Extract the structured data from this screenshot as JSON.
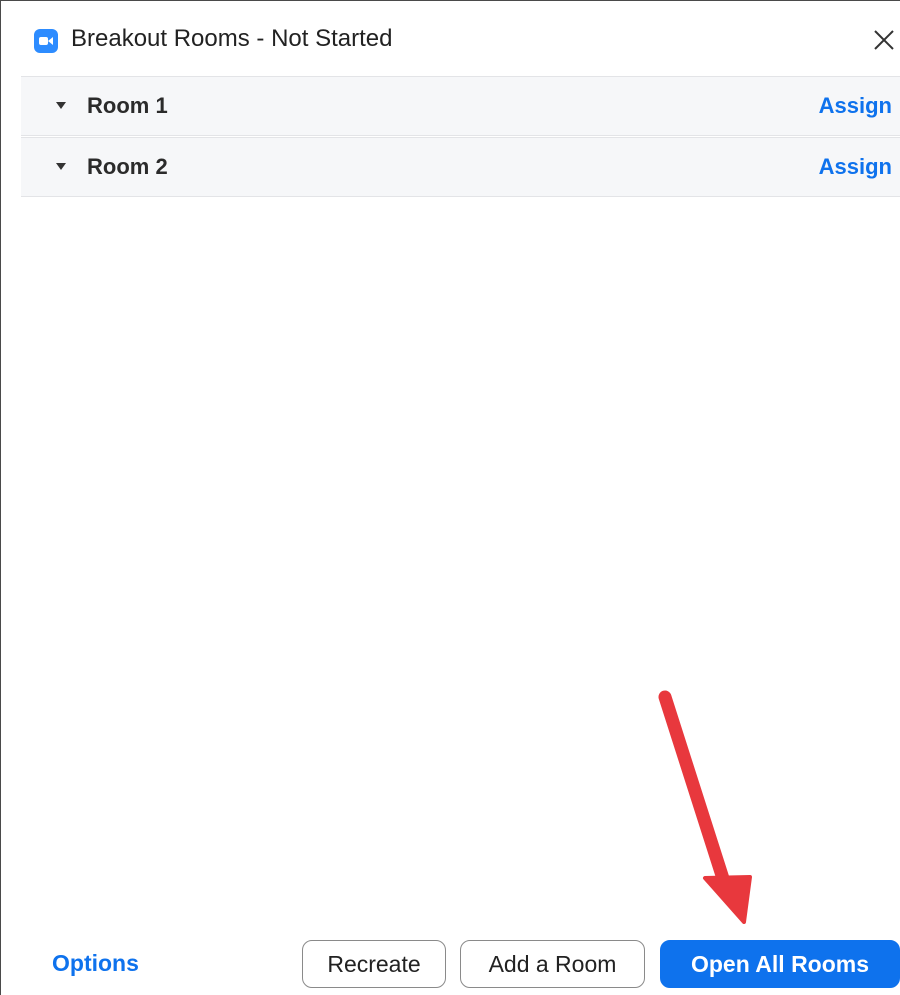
{
  "window": {
    "title": "Breakout Rooms - Not Started",
    "app_icon": "zoom-camera-icon",
    "close_icon": "close-icon"
  },
  "rooms": [
    {
      "name": "Room 1",
      "action": "Assign"
    },
    {
      "name": "Room 2",
      "action": "Assign"
    }
  ],
  "footer": {
    "options_label": "Options",
    "recreate_label": "Recreate",
    "add_room_label": "Add a Room",
    "open_all_label": "Open All Rooms"
  },
  "colors": {
    "accent": "#0e72ed",
    "annotation_arrow": "#e8383d"
  }
}
